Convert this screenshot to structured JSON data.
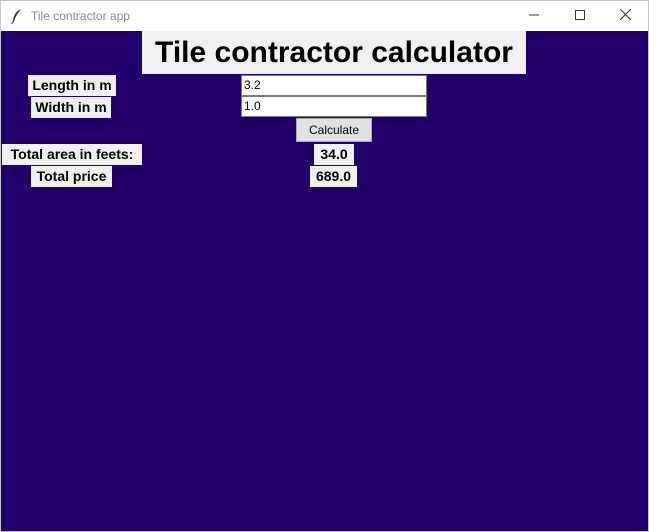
{
  "window": {
    "title": "Tile contractor app",
    "app_icon": "feather-icon",
    "controls": [
      "minimize-icon",
      "maximize-icon",
      "close-icon"
    ],
    "background_color": "#22006b"
  },
  "main": {
    "heading": "Tile contractor calculator",
    "length_label": "Length in m",
    "length_value": "3.2",
    "width_label": "Width in m",
    "width_value": "1.0",
    "calculate_label": "Calculate",
    "area_label": "Total area in feets:",
    "area_value": "34.0",
    "price_label": "Total price",
    "price_value": "689.0"
  }
}
